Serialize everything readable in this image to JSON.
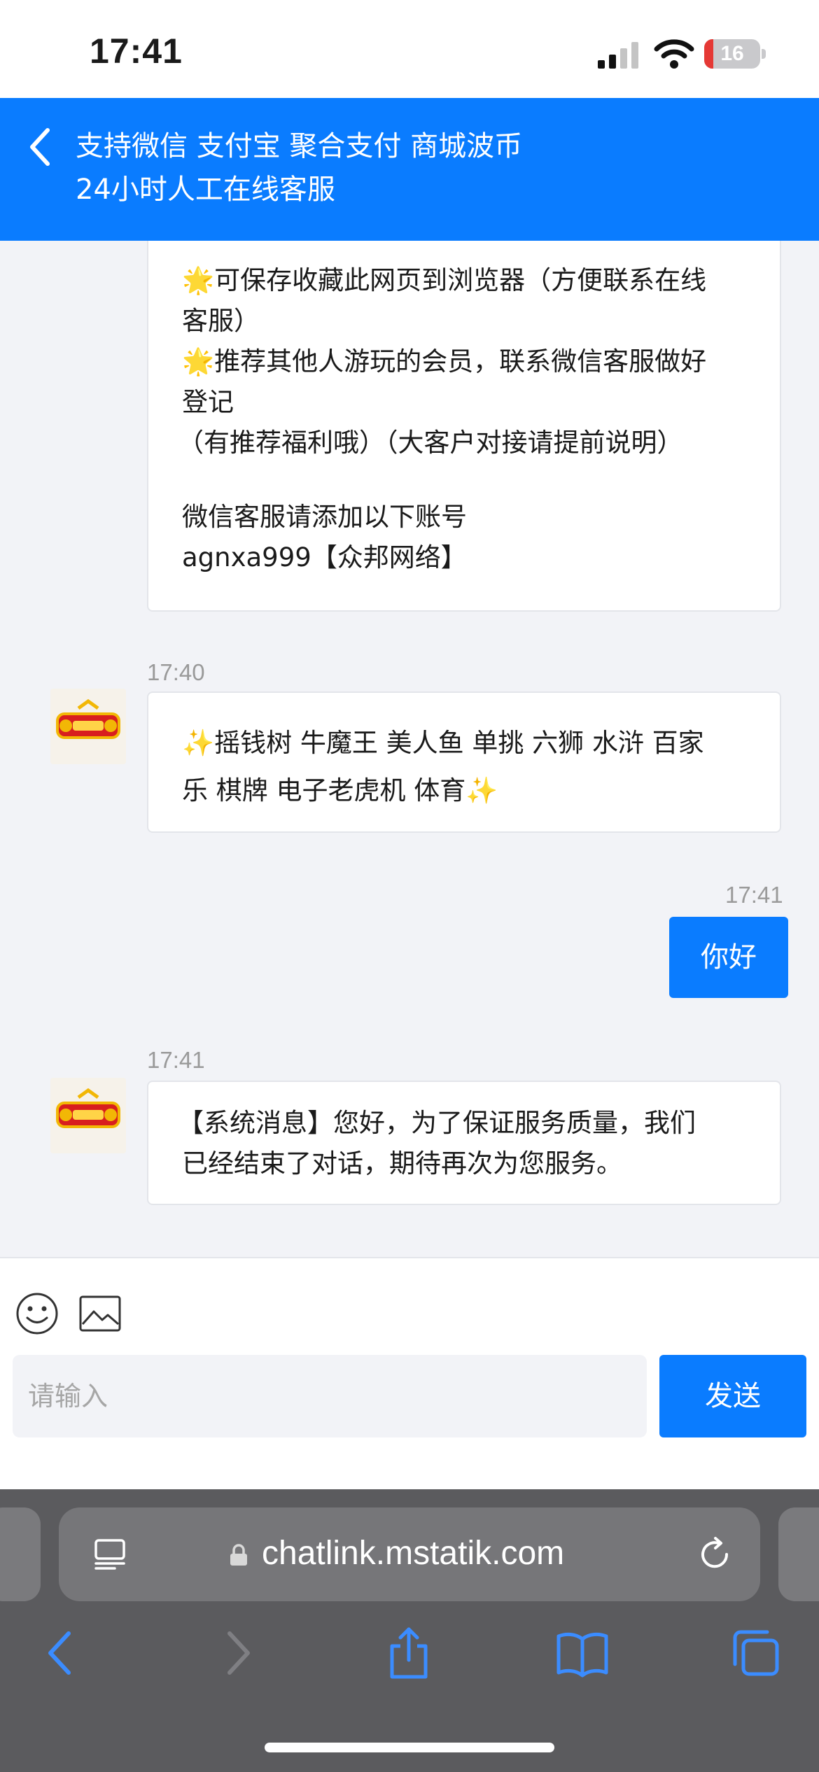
{
  "status_bar": {
    "time": "17:41",
    "battery_level": "16",
    "battery_fraction": 0.16,
    "battery_color": "#e53935"
  },
  "header": {
    "back_icon": "chevron-left-icon",
    "title_line1": "支持微信 支付宝 聚合支付 商城波币",
    "title_line2": "24小时人工在线客服",
    "background_color": "#0a7cff"
  },
  "messages": [
    {
      "type": "received",
      "lines": [
        "🌟可保存收藏此网页到浏览器（方便联系在线",
        "客服）",
        "🌟推荐其他人游玩的会员，联系微信客服做好",
        "登记",
        "（有推荐福利哦）（大客户对接请提前说明）",
        "",
        "微信客服请添加以下账号",
        "agnxa999【众邦网络】"
      ]
    },
    {
      "type": "received",
      "time": "17:40",
      "avatar_icon": "fortune-avatar-icon",
      "lines": [
        "✨摇钱树 牛魔王 美人鱼 单挑 六狮 水浒 百家",
        "乐 棋牌 电子老虎机 体育✨"
      ]
    },
    {
      "type": "sent",
      "time": "17:41",
      "text": "你好"
    },
    {
      "type": "received",
      "time": "17:41",
      "avatar_icon": "fortune-avatar-icon",
      "lines": [
        "【系统消息】您好，为了保证服务质量，我们",
        "已经结束了对话，期待再次为您服务。"
      ]
    }
  ],
  "composer": {
    "emoji_icon": "smiley-icon",
    "image_icon": "image-icon",
    "placeholder": "请输入",
    "value": "",
    "send_label": "发送"
  },
  "browser": {
    "reader_icon": "reader-icon",
    "lock_icon": "lock-icon",
    "url": "chatlink.mstatik.com",
    "reload_icon": "reload-icon",
    "nav_icons": [
      "back-arrow-icon",
      "forward-arrow-icon",
      "share-icon",
      "bookmarks-icon",
      "tabs-icon"
    ]
  }
}
